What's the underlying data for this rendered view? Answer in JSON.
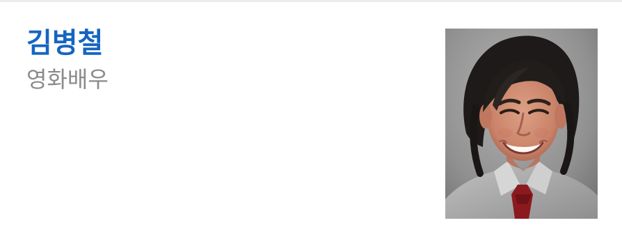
{
  "profile": {
    "name": "김병철",
    "occupation": "영화배우"
  },
  "photo": {
    "icon": "person-portrait-photo"
  },
  "colors": {
    "name": "#1565c0",
    "occupation": "#8a8a8a",
    "divider": "#ececec"
  }
}
